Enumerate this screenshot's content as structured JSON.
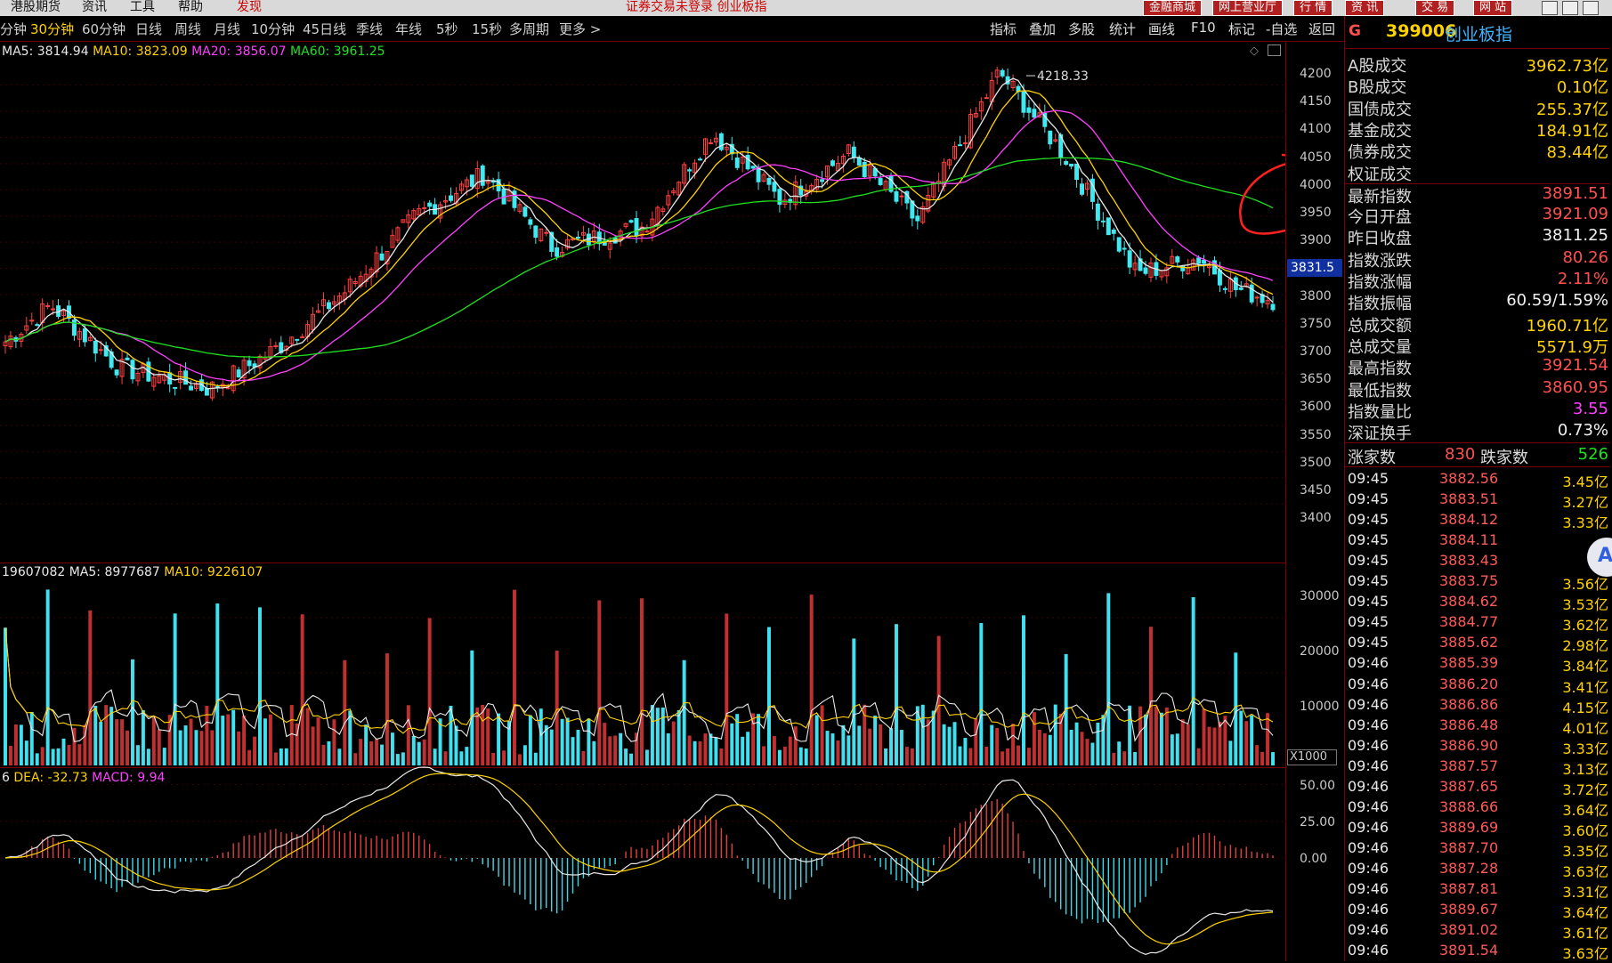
{
  "menu": {
    "items": [
      "港股期货",
      "资讯",
      "工具",
      "帮助",
      "发现"
    ],
    "title": "证券交易未登录 创业板指",
    "right_buttons": [
      "金融商城",
      "网上营业厅",
      "行 情",
      "资 讯",
      "交 易",
      "网 站"
    ]
  },
  "tabs": {
    "items": [
      "分钟",
      "30分钟",
      "60分钟",
      "日线",
      "周线",
      "月线",
      "10分钟",
      "45日线",
      "季线",
      "年线",
      "5秒",
      "15秒",
      "多周期",
      "更多 >"
    ],
    "active_index": 1,
    "right_items": [
      "指标",
      "叠加",
      "多股",
      "统计",
      "画线",
      "F10",
      "标记",
      "-自选",
      "返回"
    ]
  },
  "price_panel": {
    "ma_labels": [
      {
        "text": "MA5: 3814.94",
        "color": "#e8e8e8"
      },
      {
        "text": "MA10: 3823.09",
        "color": "#ffd200"
      },
      {
        "text": "MA20: 3856.07",
        "color": "#ff40ff"
      },
      {
        "text": "MA60: 3961.25",
        "color": "#20e020"
      }
    ],
    "y_ticks": [
      "4200",
      "4150",
      "4100",
      "4050",
      "4000",
      "3950",
      "3900",
      "3850",
      "3800",
      "3750",
      "3700",
      "3650",
      "3600",
      "3550",
      "3500",
      "3450",
      "3400"
    ],
    "high_label": "4218.33",
    "current_price_box": "3831.5"
  },
  "volume_panel": {
    "labels": [
      {
        "text": "19607082",
        "color": "#e8e8e8"
      },
      {
        "text": "MA5: 8977687",
        "color": "#e8e8e8"
      },
      {
        "text": "MA10: 9226107",
        "color": "#ffd200"
      }
    ],
    "y_ticks": [
      "30000",
      "20000",
      "10000"
    ],
    "unit_box": "X1000"
  },
  "macd_panel": {
    "labels": [
      {
        "text": "6",
        "color": "#e8e8e8"
      },
      {
        "text": "DEA: -32.73",
        "color": "#ffd200"
      },
      {
        "text": "MACD: 9.94",
        "color": "#ff40ff"
      }
    ],
    "y_ticks": [
      "50.00",
      "25.00",
      "0.00"
    ]
  },
  "quote": {
    "marker": "G",
    "code": "399006",
    "name": "创业板指",
    "rows": [
      {
        "label": "A股成交",
        "value": "3962.73亿",
        "color": "#ffd200"
      },
      {
        "label": "B股成交",
        "value": "0.10亿",
        "color": "#ffd200"
      },
      {
        "label": "国债成交",
        "value": "255.37亿",
        "color": "#ffd200"
      },
      {
        "label": "基金成交",
        "value": "184.91亿",
        "color": "#ffd200"
      },
      {
        "label": "债券成交",
        "value": "83.44亿",
        "color": "#ffd200"
      },
      {
        "label": "权证成交",
        "value": "",
        "color": "#ffd200"
      },
      {
        "label": "最新指数",
        "value": "3891.51",
        "color": "#ff5050"
      },
      {
        "label": "今日开盘",
        "value": "3921.09",
        "color": "#ff5050"
      },
      {
        "label": "昨日收盘",
        "value": "3811.25",
        "color": "#f0f0f0"
      },
      {
        "label": "指数涨跌",
        "value": "80.26",
        "color": "#ff5050"
      },
      {
        "label": "指数涨幅",
        "value": "2.11%",
        "color": "#ff5050"
      },
      {
        "label": "指数振幅",
        "value": "60.59/1.59%",
        "color": "#f0f0f0"
      },
      {
        "label": "总成交额",
        "value": "1960.71亿",
        "color": "#ffd200"
      },
      {
        "label": "总成交量",
        "value": "5571.9万",
        "color": "#ffd200"
      },
      {
        "label": "最高指数",
        "value": "3921.54",
        "color": "#ff5050"
      },
      {
        "label": "最低指数",
        "value": "3860.95",
        "color": "#ff5050"
      },
      {
        "label": "指数量比",
        "value": "3.55",
        "color": "#ff40ff"
      },
      {
        "label": "深证换手",
        "value": "0.73%",
        "color": "#f0f0f0"
      }
    ],
    "breadth": {
      "up_label": "涨家数",
      "up_value": "830",
      "down_label": "跌家数",
      "down_value": "526"
    }
  },
  "ticks": [
    {
      "time": "09:45",
      "price": "3882.56",
      "vol": "3.45亿"
    },
    {
      "time": "09:45",
      "price": "3883.51",
      "vol": "3.27亿"
    },
    {
      "time": "09:45",
      "price": "3884.12",
      "vol": "3.33亿"
    },
    {
      "time": "09:45",
      "price": "3884.11",
      "vol": ""
    },
    {
      "time": "09:45",
      "price": "3883.43",
      "vol": ""
    },
    {
      "time": "09:45",
      "price": "3883.75",
      "vol": "3.56亿"
    },
    {
      "time": "09:45",
      "price": "3884.62",
      "vol": "3.53亿"
    },
    {
      "time": "09:45",
      "price": "3884.77",
      "vol": "3.62亿"
    },
    {
      "time": "09:45",
      "price": "3885.62",
      "vol": "2.98亿"
    },
    {
      "time": "09:46",
      "price": "3885.39",
      "vol": "3.84亿"
    },
    {
      "time": "09:46",
      "price": "3886.20",
      "vol": "3.41亿"
    },
    {
      "time": "09:46",
      "price": "3886.86",
      "vol": "4.15亿"
    },
    {
      "time": "09:46",
      "price": "3886.48",
      "vol": "4.01亿"
    },
    {
      "time": "09:46",
      "price": "3886.90",
      "vol": "3.33亿"
    },
    {
      "time": "09:46",
      "price": "3887.57",
      "vol": "3.13亿"
    },
    {
      "time": "09:46",
      "price": "3887.65",
      "vol": "3.72亿"
    },
    {
      "time": "09:46",
      "price": "3888.66",
      "vol": "3.64亿"
    },
    {
      "time": "09:46",
      "price": "3889.69",
      "vol": "3.60亿"
    },
    {
      "time": "09:46",
      "price": "3887.70",
      "vol": "3.35亿"
    },
    {
      "time": "09:46",
      "price": "3887.28",
      "vol": "3.63亿"
    },
    {
      "time": "09:46",
      "price": "3887.81",
      "vol": "3.31亿"
    },
    {
      "time": "09:46",
      "price": "3889.67",
      "vol": "3.64亿"
    },
    {
      "time": "09:46",
      "price": "3891.02",
      "vol": "3.61亿"
    },
    {
      "time": "09:46",
      "price": "3891.54",
      "vol": "3.63亿"
    }
  ],
  "chart_data": {
    "type": "line",
    "series": [
      {
        "name": "MA60",
        "values": [
          3700,
          3710,
          3730,
          3760,
          3800,
          3850,
          3890,
          3910,
          3925,
          3940,
          3960,
          3990,
          4010,
          4030,
          4050,
          4040,
          4010,
          3980,
          3961
        ]
      },
      {
        "name": "MA20",
        "values": [
          3690,
          3640,
          3660,
          3700,
          3770,
          3880,
          3940,
          3910,
          3920,
          3980,
          4020,
          4060,
          4030,
          4000,
          4060,
          4100,
          3990,
          3880,
          3856
        ]
      }
    ],
    "ylim": [
      3380,
      4230
    ],
    "colors": {
      "up": "#ff4040",
      "down": "#40e8f0",
      "ma5": "#e8e8e8",
      "ma10": "#ffd200",
      "ma20": "#ff40ff",
      "ma60": "#20e020"
    }
  }
}
